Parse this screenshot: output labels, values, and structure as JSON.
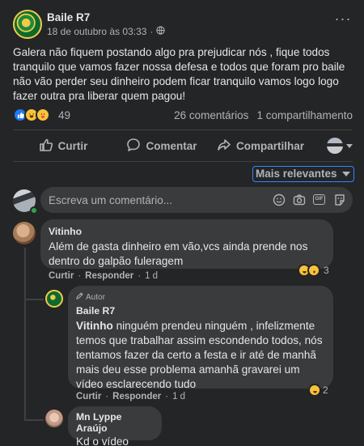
{
  "post": {
    "author": "Baile R7",
    "timestamp": "18 de outubro às 03:33",
    "visibility_icon": "globe-icon",
    "more_label": "···",
    "text": "Galera não fiquem postando algo pra prejudicar nós , fique todos tranquilo que vamos fazer nossa defesa e todos que foram pro baile não vão perder seu dinheiro podem ficar tranquilo vamos logo logo fazer outra pra liberar quem pagou!",
    "reactions": {
      "icons": [
        "like-icon",
        "haha-icon",
        "care-icon"
      ],
      "count": "49"
    },
    "comments_count": "26 comentários",
    "shares_count": "1 compartilhamento"
  },
  "actions": {
    "like": "Curtir",
    "comment": "Comentar",
    "share": "Compartilhar"
  },
  "sort": {
    "label": "Mais relevantes"
  },
  "composer": {
    "placeholder": "Escreva um comentário..."
  },
  "comments": [
    {
      "author": "Vitinho",
      "text": "Além de gasta dinheiro em vão,vcs ainda prende nos dentro do galpão fuleragem",
      "like": "Curtir",
      "reply": "Responder",
      "dot": "·",
      "time": "1 d",
      "reaction_count": "3"
    },
    {
      "badge": "Autor",
      "author": "Baile R7",
      "mention": "Vitinho",
      "text": " ninguém prendeu ninguém , infelizmente temos que trabalhar assim escondendo todos, nós tentamos fazer da certo a festa e ir até de manhã mais deu esse problema amanhã gravarei um vídeo esclarecendo tudo",
      "like": "Curtir",
      "reply": "Responder",
      "dot": "·",
      "time": "1 d",
      "reaction_count": "2"
    },
    {
      "author": "Mn Lyppe Araújo",
      "text": "Kd o vídeo"
    }
  ],
  "colors": {
    "background": "#242526",
    "bubble": "#3a3b3c",
    "accent": "#2d88ff",
    "text": "#e4e6eb",
    "muted": "#b0b3b8",
    "online": "#31a24c"
  }
}
